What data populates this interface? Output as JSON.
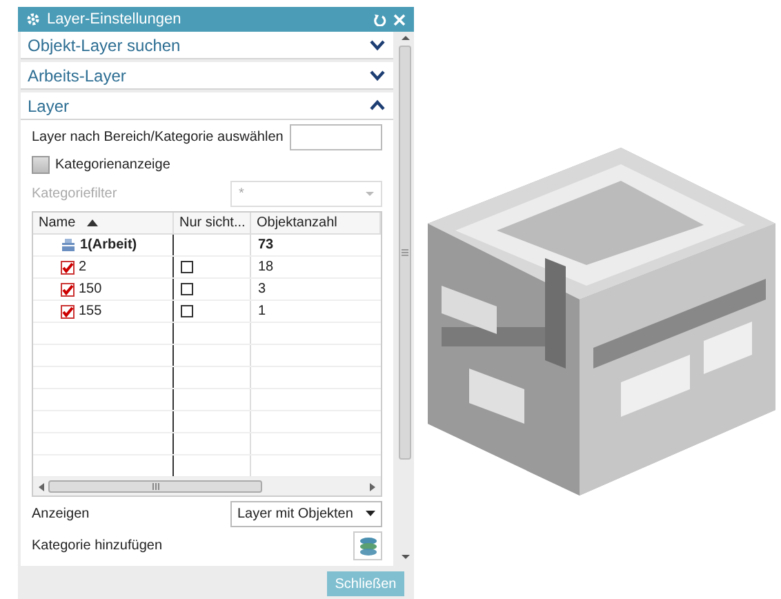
{
  "dialog": {
    "title": "Layer-Einstellungen",
    "sections": [
      {
        "title": "Objekt-Layer suchen",
        "expanded": false
      },
      {
        "title": "Arbeits-Layer",
        "expanded": false
      },
      {
        "title": "Layer",
        "expanded": true
      }
    ],
    "select_by": {
      "label": "Layer nach Bereich/Kategorie auswählen"
    },
    "category_display": {
      "label": "Kategorienanzeige",
      "checked": false
    },
    "category_filter": {
      "label": "Kategoriefilter",
      "value": "*",
      "disabled": true
    },
    "table": {
      "columns": [
        {
          "label": "Name",
          "sorted": true
        },
        {
          "label": "Nur sicht...",
          "sorted": false
        },
        {
          "label": "Objektanzahl",
          "sorted": false
        }
      ],
      "rows": [
        {
          "kind": "work",
          "name": "1(Arbeit)",
          "count": "73"
        },
        {
          "kind": "layer",
          "name": "2",
          "checked": true,
          "visible_only": false,
          "count": "18"
        },
        {
          "kind": "layer",
          "name": "150",
          "checked": true,
          "visible_only": false,
          "count": "3"
        },
        {
          "kind": "layer",
          "name": "155",
          "checked": true,
          "visible_only": false,
          "count": "1"
        }
      ]
    },
    "show": {
      "label": "Anzeigen",
      "value": "Layer mit Objekten"
    },
    "add_category": {
      "label": "Kategorie hinzufügen"
    },
    "close_button": "Schließen"
  }
}
